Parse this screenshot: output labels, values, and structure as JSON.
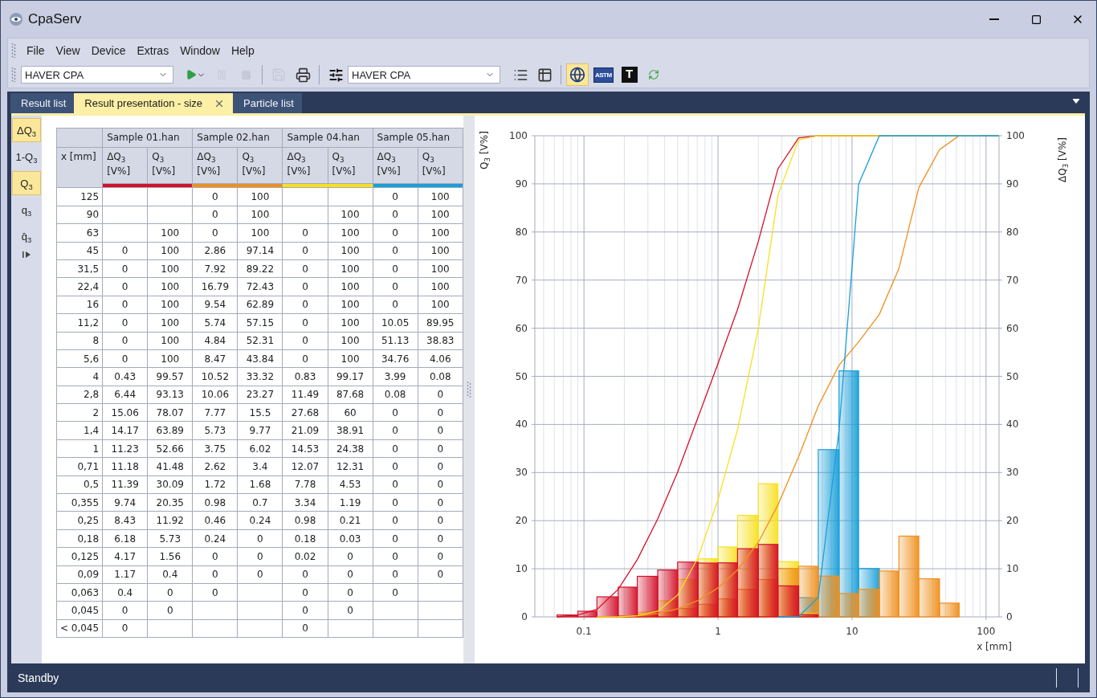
{
  "window": {
    "title": "CpaServ"
  },
  "menu": [
    "File",
    "View",
    "Device",
    "Extras",
    "Window",
    "Help"
  ],
  "toolbar": [
    {
      "kind": "dropdown",
      "value": "HAVER CPA"
    },
    {
      "kind": "play",
      "disabled": false,
      "selected": false
    },
    {
      "kind": "pause",
      "disabled": true,
      "selected": false
    },
    {
      "kind": "stop",
      "disabled": true,
      "selected": false
    },
    {
      "kind": "separator"
    },
    {
      "kind": "save",
      "disabled": true,
      "selected": false
    },
    {
      "kind": "print",
      "disabled": false,
      "selected": false
    },
    {
      "kind": "separator"
    },
    {
      "kind": "settings",
      "disabled": false,
      "selected": false
    },
    {
      "kind": "dropdown",
      "value": "HAVER CPA"
    },
    {
      "kind": "list",
      "disabled": false,
      "selected": false
    },
    {
      "kind": "table",
      "disabled": false,
      "selected": false
    },
    {
      "kind": "separator"
    },
    {
      "kind": "globe",
      "disabled": false,
      "selected": true
    },
    {
      "kind": "astm",
      "label": "ASTM",
      "disabled": false,
      "selected": false
    },
    {
      "kind": "tyler",
      "label": "T",
      "disabled": false,
      "selected": false
    },
    {
      "kind": "refresh",
      "disabled": false,
      "selected": false
    }
  ],
  "tabs": [
    {
      "label": "Result list",
      "selected": false,
      "closable": false
    },
    {
      "label": "Result presentation - size",
      "selected": true,
      "closable": true
    },
    {
      "label": "Particle list",
      "selected": false,
      "closable": false
    }
  ],
  "view_buttons": [
    {
      "label": "ΔQ$_{3}$",
      "selected": true
    },
    {
      "label": "1-Q$_{3}$",
      "selected": false
    },
    {
      "label": "Q$_{3}$",
      "selected": true
    },
    {
      "label": "q$_{3}$",
      "selected": false
    },
    {
      "label": "q̄$_{3}$",
      "selected": false
    }
  ],
  "table": {
    "x_header": "x [mm]",
    "samples": [
      {
        "name": "Sample 01.han",
        "color": "#d4112b",
        "columns": [
          "ΔQ$_{3}$\n[V%]",
          "Q$_{3}$\n[V%]"
        ]
      },
      {
        "name": "Sample 02.han",
        "color": "#f0901e",
        "columns": [
          "ΔQ$_{3}$\n[V%]",
          "Q$_{3}$\n[V%]"
        ]
      },
      {
        "name": "Sample 04.han",
        "color": "#f8e020",
        "columns": [
          "ΔQ$_{3}$\n[V%]",
          "Q$_{3}$\n[V%]"
        ]
      },
      {
        "name": "Sample 05.han",
        "color": "#1a9fd9",
        "columns": [
          "ΔQ$_{3}$\n[V%]",
          "Q$_{3}$\n[V%]"
        ]
      }
    ],
    "rows": [
      [
        "125",
        null,
        null,
        "0",
        "100",
        null,
        null,
        "0",
        "100"
      ],
      [
        "90",
        null,
        null,
        "0",
        "100",
        null,
        "100",
        "0",
        "100"
      ],
      [
        "63",
        null,
        "100",
        "0",
        "100",
        "0",
        "100",
        "0",
        "100"
      ],
      [
        "45",
        "0",
        "100",
        "2.86",
        "97.14",
        "0",
        "100",
        "0",
        "100"
      ],
      [
        "31,5",
        "0",
        "100",
        "7.92",
        "89.22",
        "0",
        "100",
        "0",
        "100"
      ],
      [
        "22,4",
        "0",
        "100",
        "16.79",
        "72.43",
        "0",
        "100",
        "0",
        "100"
      ],
      [
        "16",
        "0",
        "100",
        "9.54",
        "62.89",
        "0",
        "100",
        "0",
        "100"
      ],
      [
        "11,2",
        "0",
        "100",
        "5.74",
        "57.15",
        "0",
        "100",
        "10.05",
        "89.95"
      ],
      [
        "8",
        "0",
        "100",
        "4.84",
        "52.31",
        "0",
        "100",
        "51.13",
        "38.83"
      ],
      [
        "5,6",
        "0",
        "100",
        "8.47",
        "43.84",
        "0",
        "100",
        "34.76",
        "4.06"
      ],
      [
        "4",
        "0.43",
        "99.57",
        "10.52",
        "33.32",
        "0.83",
        "99.17",
        "3.99",
        "0.08"
      ],
      [
        "2,8",
        "6.44",
        "93.13",
        "10.06",
        "23.27",
        "11.49",
        "87.68",
        "0.08",
        "0"
      ],
      [
        "2",
        "15.06",
        "78.07",
        "7.77",
        "15.5",
        "27.68",
        "60",
        "0",
        "0"
      ],
      [
        "1,4",
        "14.17",
        "63.89",
        "5.73",
        "9.77",
        "21.09",
        "38.91",
        "0",
        "0"
      ],
      [
        "1",
        "11.23",
        "52.66",
        "3.75",
        "6.02",
        "14.53",
        "24.38",
        "0",
        "0"
      ],
      [
        "0,71",
        "11.18",
        "41.48",
        "2.62",
        "3.4",
        "12.07",
        "12.31",
        "0",
        "0"
      ],
      [
        "0,5",
        "11.39",
        "30.09",
        "1.72",
        "1.68",
        "7.78",
        "4.53",
        "0",
        "0"
      ],
      [
        "0,355",
        "9.74",
        "20.35",
        "0.98",
        "0.7",
        "3.34",
        "1.19",
        "0",
        "0"
      ],
      [
        "0,25",
        "8.43",
        "11.92",
        "0.46",
        "0.24",
        "0.98",
        "0.21",
        "0",
        "0"
      ],
      [
        "0,18",
        "6.18",
        "5.73",
        "0.24",
        "0",
        "0.18",
        "0.03",
        "0",
        "0"
      ],
      [
        "0,125",
        "4.17",
        "1.56",
        "0",
        "0",
        "0.02",
        "0",
        "0",
        "0"
      ],
      [
        "0,09",
        "1.17",
        "0.4",
        "0",
        "0",
        "0",
        "0",
        "0",
        "0"
      ],
      [
        "0,063",
        "0.4",
        "0",
        "0",
        null,
        "0",
        "0",
        "0",
        null
      ],
      [
        "0,045",
        "0",
        "0",
        null,
        null,
        "0",
        "0",
        null,
        null
      ],
      [
        "< 0,045",
        "0",
        null,
        null,
        null,
        "0",
        null,
        null,
        null
      ]
    ]
  },
  "chart": {
    "y_label": "Q$_{3}$ [V%]",
    "y2_label": "ΔQ$_{3}$ [V%]",
    "x_label": "x [mm]",
    "y_ticks": [
      "100",
      "90",
      "80",
      "70",
      "60",
      "50",
      "40",
      "30",
      "20",
      "10",
      "0"
    ],
    "y2_ticks": [
      "100",
      "90",
      "80",
      "70",
      "60",
      "50",
      "40",
      "30",
      "20",
      "10",
      "0"
    ],
    "x_ticks": [
      "0.1",
      "1",
      "10",
      "100"
    ]
  },
  "status_bar": {
    "text": "Standby"
  }
}
